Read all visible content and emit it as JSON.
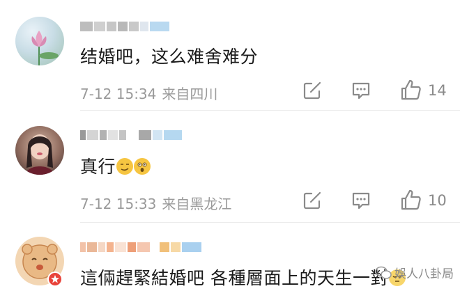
{
  "comments": [
    {
      "text": "结婚吧，这么难舍难分",
      "time": "7-12 15:34",
      "location": "来自四川",
      "likes": "14"
    },
    {
      "text": "真行",
      "time": "7-12 15:33",
      "location": "来自黑龙江",
      "likes": "10"
    },
    {
      "text": "這倆趕緊結婚吧 各種層面上的天生一對"
    }
  ],
  "watermark": "娛人八卦局",
  "colors": {
    "text": "#1a1a1a",
    "meta": "#9a9a9a",
    "icon": "#8a8a8a",
    "divider": "#ececec"
  }
}
